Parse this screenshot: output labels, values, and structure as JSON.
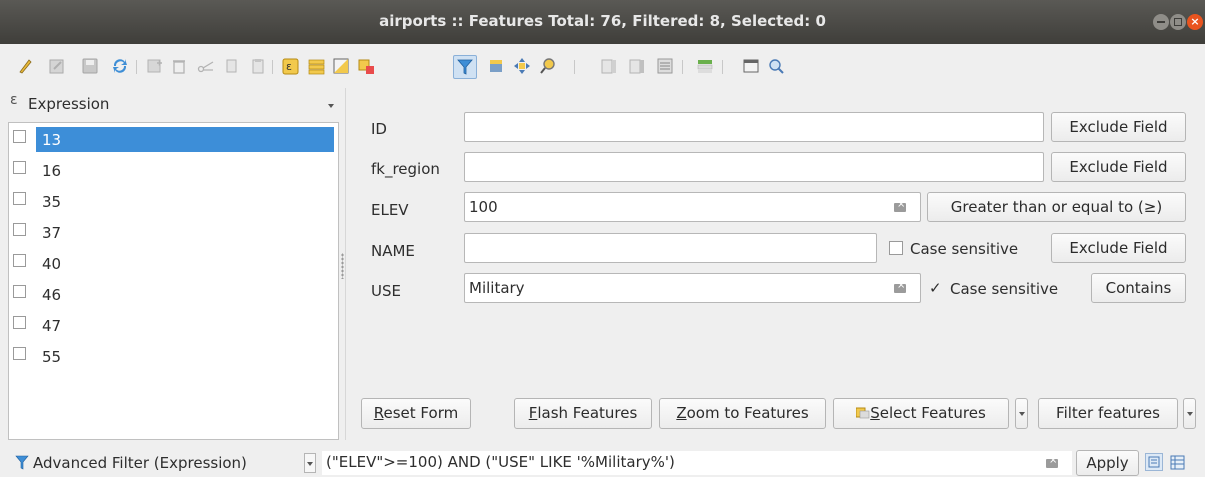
{
  "window": {
    "title": "airports :: Features Total: 76, Filtered: 8, Selected: 0",
    "close_glyph": "×"
  },
  "toolbar": {
    "icons": [
      "toggle-editing-icon",
      "multi-edit-icon",
      "save-edits-icon",
      "reload-icon",
      "add-feature-icon",
      "delete-feature-icon",
      "cut-icon",
      "copy-icon",
      "paste-icon",
      "expression-select-icon",
      "select-all-icon",
      "invert-selection-icon",
      "deselect-all-icon",
      "filter-icon",
      "move-selection-top-icon",
      "pan-to-selection-icon",
      "zoom-to-selection-icon",
      "new-field-icon",
      "delete-field-icon",
      "field-calculator-icon",
      "conditional-format-icon",
      "dock-icon",
      "actions-icon"
    ],
    "active_icon": "filter-icon"
  },
  "left_panel": {
    "header_label": "Expression",
    "items": [
      {
        "label": "13",
        "selected": true
      },
      {
        "label": "16",
        "selected": false
      },
      {
        "label": "35",
        "selected": false
      },
      {
        "label": "37",
        "selected": false
      },
      {
        "label": "40",
        "selected": false
      },
      {
        "label": "46",
        "selected": false
      },
      {
        "label": "47",
        "selected": false
      },
      {
        "label": "55",
        "selected": false
      }
    ]
  },
  "form": {
    "fields": [
      {
        "label": "ID",
        "value": "",
        "button": "Exclude Field"
      },
      {
        "label": "fk_region",
        "value": "",
        "button": "Exclude Field"
      },
      {
        "label": "ELEV",
        "value": "100",
        "button": "Greater than or equal to (≥)"
      },
      {
        "label": "NAME",
        "value": "",
        "case_sensitive_label": "Case sensitive",
        "case_sensitive_checked": false,
        "button": "Exclude Field"
      },
      {
        "label": "USE",
        "value": "Military",
        "case_sensitive_label": "Case sensitive",
        "case_sensitive_checked": true,
        "button": "Contains"
      }
    ],
    "check_glyph": "✓",
    "reset_label_u": "R",
    "reset_label_rest": "eset Form",
    "flash_label_u": "F",
    "flash_label_rest": "lash Features",
    "zoom_label_u": "Z",
    "zoom_label_rest": "oom to Features",
    "select_label_u": "S",
    "select_label_rest": "elect Features",
    "filter_label": "Filter features"
  },
  "status": {
    "filter_mode": "Advanced Filter (Expression)",
    "expression": "(\"ELEV\">=100) AND (\"USE\" LIKE '%Military%')",
    "apply_label": "Apply"
  },
  "colors": {
    "selection": "#3d8ed8",
    "titlebar": "#4a4945",
    "close_button": "#e9541f"
  }
}
